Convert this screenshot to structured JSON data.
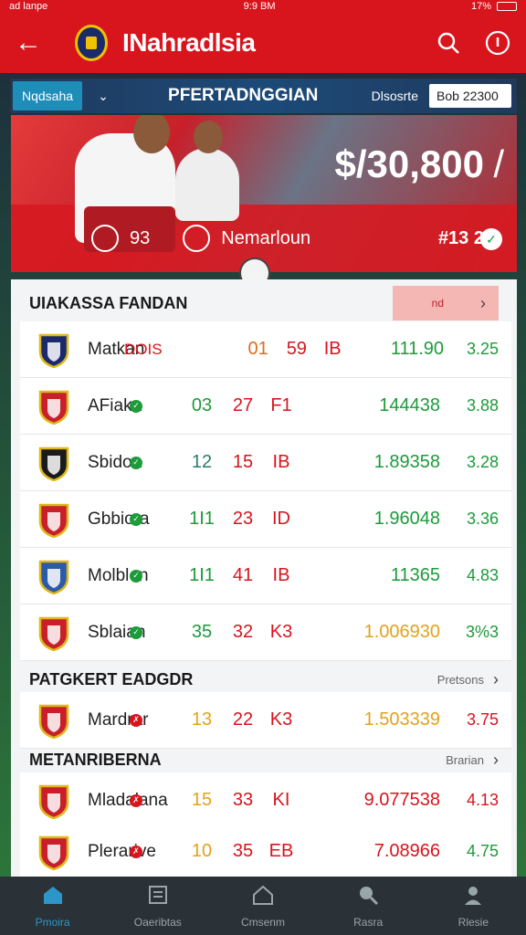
{
  "status_bar": {
    "left": "ad lanpe",
    "time": "9:9 BM",
    "right": "17%"
  },
  "app_bar": {
    "title": "INahradlsia"
  },
  "sub_header": {
    "pill": "Nqdsaha",
    "title": "PFERTADNGGIAN",
    "right_label": "Dlsosrte",
    "box_label": "Bob",
    "box_value": "22300"
  },
  "hero": {
    "price": "$/30,800",
    "slash": "/",
    "number": "93",
    "label": "Nemarloun",
    "score": "#13 2"
  },
  "sections": [
    {
      "title": "UIAKASSA FANDAN",
      "action": "nd",
      "rows": [
        {
          "name": "Matkan",
          "badge": "DOIS",
          "n1": "01",
          "n2": "59",
          "n3": "IB",
          "value": "111.90",
          "value2": "3.25",
          "n1_color": "#e46a1a",
          "n2_color": "#d8141d",
          "value_color": "#1c9b3a",
          "value2_color": "#1c9b3a",
          "dot": "none",
          "crest": "#1a2a6c"
        },
        {
          "name": "AFiaka",
          "badge": "",
          "n1": "03",
          "n2": "27",
          "n3": "F1",
          "value": "144438",
          "value2": "3.88",
          "n1_color": "#1c9b3a",
          "n2_color": "#d8141d",
          "value_color": "#1c9b3a",
          "value2_color": "#1c9b3a",
          "dot": "green",
          "crest": "#c7202a"
        },
        {
          "name": "Sbidoa",
          "badge": "",
          "n1": "12",
          "n2": "15",
          "n3": "IB",
          "value": "1.89358",
          "value2": "3.28",
          "n1_color": "#2a7e6a",
          "n2_color": "#d8141d",
          "value_color": "#1c9b3a",
          "value2_color": "#1c9b3a",
          "dot": "green",
          "crest": "#1a1a1a"
        },
        {
          "name": "Gbbiora",
          "badge": "",
          "n1": "1I1",
          "n2": "23",
          "n3": "ID",
          "value": "1.96048",
          "value2": "3.36",
          "n1_color": "#1c9b3a",
          "n2_color": "#d8141d",
          "value_color": "#1c9b3a",
          "value2_color": "#1c9b3a",
          "dot": "green",
          "crest": "#c7202a"
        },
        {
          "name": "Molblon",
          "badge": "",
          "n1": "1I1",
          "n2": "41",
          "n3": "IB",
          "value": "11365",
          "value2": "4.83",
          "n1_color": "#1c9b3a",
          "n2_color": "#d8141d",
          "value_color": "#1c9b3a",
          "value2_color": "#1c9b3a",
          "dot": "green",
          "crest": "#2c5aa8"
        },
        {
          "name": "Sblaian",
          "badge": "",
          "n1": "35",
          "n2": "32",
          "n3": "K3",
          "value": "1.006930",
          "value2": "3%3",
          "n1_color": "#1c9b3a",
          "n2_color": "#d8141d",
          "value_color": "#e3a21a",
          "value2_color": "#1c9b3a",
          "dot": "green",
          "crest": "#c7202a"
        }
      ]
    },
    {
      "title": "PATGKERT EADGDR",
      "action": "Pretsons",
      "rows": [
        {
          "name": "Mardrar",
          "badge": "",
          "n1": "13",
          "n2": "22",
          "n3": "K3",
          "value": "1.503339",
          "value2": "3.75",
          "n1_color": "#e3a21a",
          "n2_color": "#d8141d",
          "value_color": "#e3a21a",
          "value2_color": "#d8141d",
          "dot": "red",
          "crest": "#c7202a"
        }
      ]
    },
    {
      "title": "METANRIBERNA",
      "action": "Brarian",
      "rows": [
        {
          "name": "Mladalana",
          "badge": "",
          "n1": "15",
          "n2": "33",
          "n3": "KI",
          "value": "9.077538",
          "value2": "4.13",
          "n1_color": "#e3a21a",
          "n2_color": "#d8141d",
          "value_color": "#d8141d",
          "value2_color": "#d8141d",
          "dot": "red",
          "crest": "#c7202a"
        },
        {
          "name": "Plerarive",
          "badge": "",
          "n1": "10",
          "n2": "35",
          "n3": "EB",
          "value": "7.08966",
          "value2": "4.75",
          "n1_color": "#e3a21a",
          "n2_color": "#d8141d",
          "value_color": "#d8141d",
          "value2_color": "#1c9b3a",
          "dot": "red",
          "crest": "#c7202a"
        }
      ]
    }
  ],
  "bottom_nav": [
    {
      "label": "Pmoira",
      "icon": "home-icon",
      "active": true
    },
    {
      "label": "Oaeribtas",
      "icon": "list-icon",
      "active": false
    },
    {
      "label": "Cmsenm",
      "icon": "house-icon",
      "active": false
    },
    {
      "label": "Rasra",
      "icon": "search-icon",
      "active": false
    },
    {
      "label": "Rlesie",
      "icon": "user-icon",
      "active": false
    }
  ]
}
